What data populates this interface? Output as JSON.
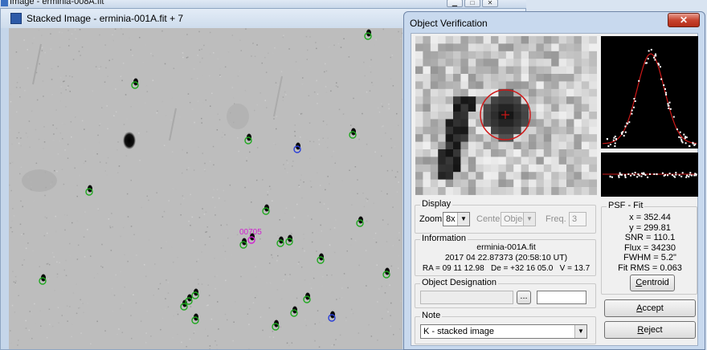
{
  "back_window": {
    "title": "Image - erminia-008A.fit"
  },
  "stacked_window": {
    "title": "Stacked Image - erminia-001A.fit + 7",
    "target_label": "00705"
  },
  "dialog": {
    "title": "Object Verification",
    "close_symbol": "✕",
    "display": {
      "legend": "Display",
      "zoom_label": "Zoom",
      "zoom_value": "8x",
      "center_label": "Center",
      "center_value": "Object",
      "freq_label": "Freq.",
      "freq_value": "3"
    },
    "information": {
      "legend": "Information",
      "filename": "erminia-001A.fit",
      "datetime": "2017 04 22.87373 (20:58:10 UT)",
      "coords": "RA = 09 11 12.98   De = +32 16 05.0   V = 13.7"
    },
    "designation": {
      "legend": "Object Designation",
      "value": "",
      "button_label": "..."
    },
    "note": {
      "legend": "Note",
      "value": "K - stacked image"
    },
    "psf": {
      "legend": "PSF - Fit",
      "lines": [
        "x = 352.44",
        "y = 299.81",
        "SNR = 110.1",
        "Flux = 34230",
        "FWHM = 5.2\"",
        "Fit RMS = 0.063"
      ],
      "centroid_prefix": "C",
      "centroid_rest": "entroid"
    },
    "accept": {
      "prefix": "A",
      "rest": "ccept"
    },
    "reject": {
      "prefix": "R",
      "rest": "eject"
    }
  },
  "colors": {
    "star_marker": "#1fa81f",
    "moving_marker": "#2a3fd8",
    "target_label": "#d020d0",
    "psf_curve": "#d01818",
    "aperture_circle": "#d01818"
  }
}
